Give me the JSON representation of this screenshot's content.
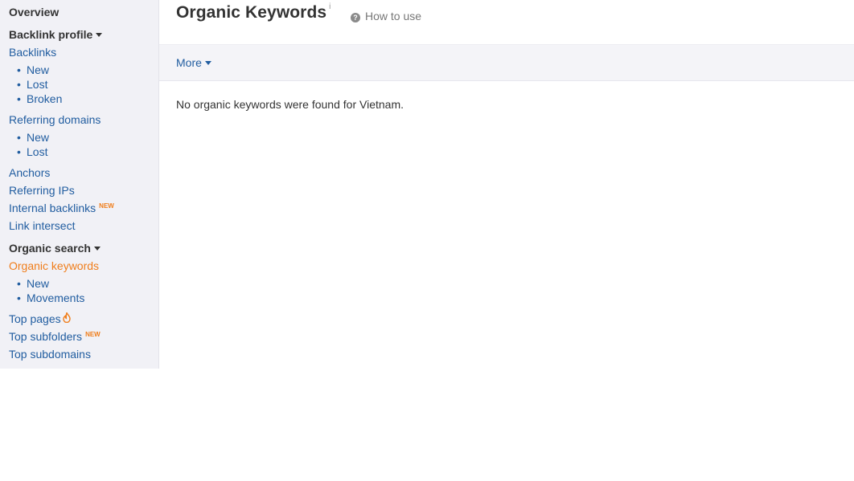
{
  "sidebar": {
    "overview": "Overview",
    "backlink_profile": {
      "label": "Backlink profile"
    },
    "backlinks": "Backlinks",
    "backlinks_sub": [
      "New",
      "Lost",
      "Broken"
    ],
    "referring_domains": "Referring domains",
    "referring_domains_sub": [
      "New",
      "Lost"
    ],
    "anchors": "Anchors",
    "referring_ips": "Referring IPs",
    "internal_backlinks": "Internal backlinks",
    "internal_backlinks_badge": "NEW",
    "link_intersect": "Link intersect",
    "organic_search": {
      "label": "Organic search"
    },
    "organic_keywords": "Organic keywords",
    "organic_keywords_sub": [
      "New",
      "Movements"
    ],
    "top_pages": "Top pages",
    "top_subfolders": "Top subfolders",
    "top_subfolders_badge": "NEW",
    "top_subdomains": "Top subdomains",
    "bullet": "•"
  },
  "header": {
    "title": "Organic Keywords",
    "info_marker": "i",
    "how_to_use": "How to use",
    "help_glyph": "?"
  },
  "toolbar": {
    "more_label": "More"
  },
  "main": {
    "empty_message": "No organic keywords were found for Vietnam."
  },
  "colors": {
    "link": "#215da0",
    "active": "#f07d1a",
    "sidebar_bg": "#f1f1f6",
    "toolbar_bg": "#f4f4f8"
  }
}
